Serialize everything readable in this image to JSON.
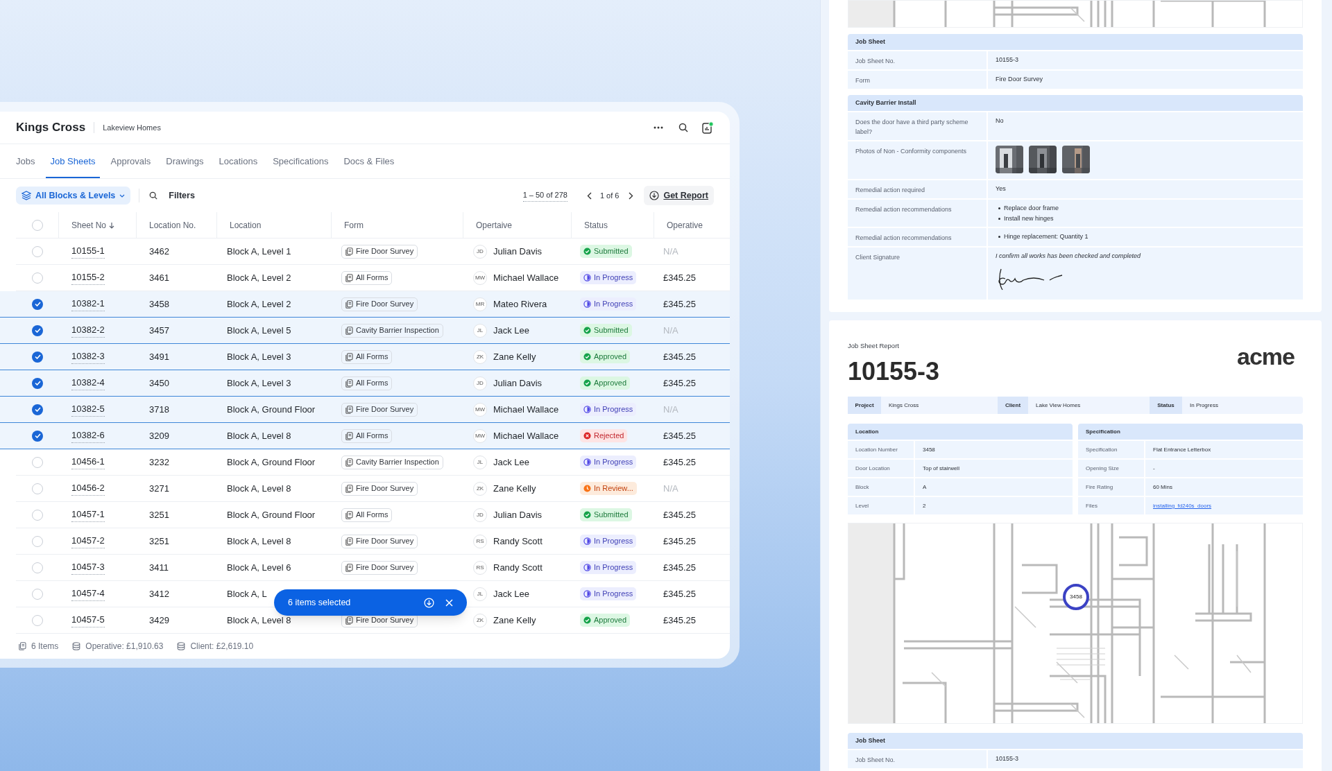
{
  "project": {
    "title": "Kings Cross",
    "client": "Lakeview Homes"
  },
  "tabs": [
    {
      "label": "Jobs",
      "selected": false
    },
    {
      "label": "Job Sheets",
      "selected": true
    },
    {
      "label": "Approvals",
      "selected": false
    },
    {
      "label": "Drawings",
      "selected": false
    },
    {
      "label": "Locations",
      "selected": false
    },
    {
      "label": "Specifications",
      "selected": false
    },
    {
      "label": "Docs & Files",
      "selected": false
    }
  ],
  "toolbar": {
    "filter": "All Blocks & Levels",
    "filters_label": "Filters",
    "range": "1 – 50 of 278",
    "page": "1 of 6",
    "report_button": "Get Report"
  },
  "table": {
    "select_all": false,
    "columns": [
      "Sheet No",
      "Location No.",
      "Location",
      "Form",
      "Opertaive",
      "Status",
      "Operative"
    ],
    "rows": [
      {
        "selected": false,
        "sheet": "10155-1",
        "location_no": "3462",
        "location": "Block A, Level 1",
        "form": "Fire Door Survey",
        "initials": "JD",
        "person": "Julian Davis",
        "status": {
          "label": "Submitted",
          "kind": "submitted"
        },
        "operative": "N/A",
        "operative_muted": true
      },
      {
        "selected": false,
        "sheet": "10155-2",
        "location_no": "3461",
        "location": "Block A, Level 2",
        "form": "All Forms",
        "initials": "MW",
        "person": "Michael Wallace",
        "status": {
          "label": "In Progress",
          "kind": "in_progress"
        },
        "operative": "£345.25",
        "operative_muted": false
      },
      {
        "selected": true,
        "sheet": "10382-1",
        "location_no": "3458",
        "location": "Block A, Level 2",
        "form": "Fire Door Survey",
        "initials": "MR",
        "person": "Mateo Rivera",
        "status": {
          "label": "In Progress",
          "kind": "in_progress"
        },
        "operative": "£345.25",
        "operative_muted": false
      },
      {
        "selected": true,
        "sheet": "10382-2",
        "location_no": "3457",
        "location": "Block A, Level 5",
        "form": "Cavity Barrier Inspection",
        "initials": "JL",
        "person": "Jack Lee",
        "status": {
          "label": "Submitted",
          "kind": "submitted"
        },
        "operative": "N/A",
        "operative_muted": true
      },
      {
        "selected": true,
        "sheet": "10382-3",
        "location_no": "3491",
        "location": "Block A, Level 3",
        "form": "All Forms",
        "initials": "ZK",
        "person": "Zane Kelly",
        "status": {
          "label": "Approved",
          "kind": "approved"
        },
        "operative": "£345.25",
        "operative_muted": false
      },
      {
        "selected": true,
        "sheet": "10382-4",
        "location_no": "3450",
        "location": "Block A, Level 3",
        "form": "All Forms",
        "initials": "JD",
        "person": "Julian Davis",
        "status": {
          "label": "Approved",
          "kind": "approved"
        },
        "operative": "£345.25",
        "operative_muted": false
      },
      {
        "selected": true,
        "sheet": "10382-5",
        "location_no": "3718",
        "location": "Block A, Ground Floor",
        "form": "Fire Door Survey",
        "initials": "MW",
        "person": "Michael Wallace",
        "status": {
          "label": "In Progress",
          "kind": "in_progress"
        },
        "operative": "N/A",
        "operative_muted": true
      },
      {
        "selected": true,
        "sheet": "10382-6",
        "location_no": "3209",
        "location": "Block A, Level 8",
        "form": "All Forms",
        "initials": "MW",
        "person": "Michael Wallace",
        "status": {
          "label": "Rejected",
          "kind": "rejected"
        },
        "operative": "£345.25",
        "operative_muted": false
      },
      {
        "selected": false,
        "sheet": "10456-1",
        "location_no": "3232",
        "location": "Block A, Ground Floor",
        "form": "Cavity Barrier Inspection",
        "initials": "JL",
        "person": "Jack Lee",
        "status": {
          "label": "In Progress",
          "kind": "in_progress"
        },
        "operative": "£345.25",
        "operative_muted": false
      },
      {
        "selected": false,
        "sheet": "10456-2",
        "location_no": "3271",
        "location": "Block A, Level 8",
        "form": "Fire Door Survey",
        "initials": "ZK",
        "person": "Zane Kelly",
        "status": {
          "label": "In Review...",
          "kind": "in_review"
        },
        "operative": "N/A",
        "operative_muted": true
      },
      {
        "selected": false,
        "sheet": "10457-1",
        "location_no": "3251",
        "location": "Block A, Ground Floor",
        "form": "All Forms",
        "initials": "JD",
        "person": "Julian Davis",
        "status": {
          "label": "Submitted",
          "kind": "submitted"
        },
        "operative": "£345.25",
        "operative_muted": false
      },
      {
        "selected": false,
        "sheet": "10457-2",
        "location_no": "3251",
        "location": "Block A, Level 8",
        "form": "Fire Door Survey",
        "initials": "RS",
        "person": "Randy Scott",
        "status": {
          "label": "In Progress",
          "kind": "in_progress"
        },
        "operative": "£345.25",
        "operative_muted": false
      },
      {
        "selected": false,
        "sheet": "10457-3",
        "location_no": "3411",
        "location": "Block A, Level 6",
        "form": "Fire Door Survey",
        "initials": "RS",
        "person": "Randy Scott",
        "status": {
          "label": "In Progress",
          "kind": "in_progress"
        },
        "operative": "£345.25",
        "operative_muted": false
      },
      {
        "selected": false,
        "sheet": "10457-4",
        "location_no": "3412",
        "location": "Block A, L",
        "initials": "JL",
        "person": "Jack Lee",
        "status": {
          "label": "In Progress",
          "kind": "in_progress"
        },
        "operative": "£345.25",
        "operative_muted": false
      },
      {
        "selected": false,
        "sheet": "10457-5",
        "location_no": "3429",
        "location": "Block A, Level 8",
        "form": "Fire Door Survey",
        "initials": "ZK",
        "person": "Zane Kelly",
        "status": {
          "label": "Approved",
          "kind": "approved"
        },
        "operative": "£345.25",
        "operative_muted": false
      }
    ]
  },
  "selection_toast": {
    "label": "6 items selected"
  },
  "footer": {
    "items": "6 Items",
    "operative": "Operative: £1,910.63",
    "client": "Client: £2,619.10"
  },
  "report_top": {
    "sections": [
      {
        "title": "Job Sheet",
        "rows": [
          {
            "kind": "text",
            "label": "Job Sheet No.",
            "value": "10155-3"
          },
          {
            "kind": "text",
            "label": "Form",
            "value": "Fire Door Survey"
          }
        ]
      },
      {
        "title": "Cavity Barrier Install",
        "rows": [
          {
            "kind": "text",
            "label": "Does the door have a third party scheme label?",
            "value": "No"
          },
          {
            "kind": "photos",
            "label": "Photos of Non - Conformity components"
          },
          {
            "kind": "text",
            "label": "Remedial action required",
            "value": "Yes"
          },
          {
            "kind": "list",
            "label": "Remedial action recommendations",
            "items": [
              "Replace door frame",
              "Install new hinges"
            ]
          },
          {
            "kind": "list",
            "label": "Remedial action recommendations",
            "items": [
              "Hinge replacement: Quantity 1"
            ]
          },
          {
            "kind": "signature",
            "label": "Client Signature",
            "value": "I confirm all works has been checked and completed"
          }
        ]
      }
    ]
  },
  "report": {
    "heading": "Job Sheet Report",
    "number": "10155-3",
    "logo": "acme",
    "summary": [
      {
        "label": "Project",
        "value": "Kings Cross"
      },
      {
        "label": "Client",
        "value": "Lake View Homes"
      },
      {
        "label": "Status",
        "value": "In Progress"
      }
    ],
    "tables": [
      {
        "title": "Location",
        "rows": [
          {
            "kind": "text",
            "label": "Location Number",
            "value": "3458"
          },
          {
            "kind": "text",
            "label": "Door Location",
            "value": "Top of stairwell"
          },
          {
            "kind": "text",
            "label": "Block",
            "value": "A"
          },
          {
            "kind": "text",
            "label": "Level",
            "value": "2"
          }
        ]
      },
      {
        "title": "Specification",
        "rows": [
          {
            "kind": "text",
            "label": "Specification",
            "value": "Flat Entrance Letterbox"
          },
          {
            "kind": "text",
            "label": "Opening Size",
            "value": "-"
          },
          {
            "kind": "text",
            "label": "Fire Rating",
            "value": "60 Mins"
          },
          {
            "kind": "link",
            "label": "Files",
            "value": "installing_fd240s_doors"
          }
        ]
      }
    ],
    "pin": "3458",
    "sections": [
      {
        "title": "Job Sheet",
        "rows": [
          {
            "kind": "text",
            "label": "Job Sheet No.",
            "value": "10155-3"
          }
        ]
      }
    ]
  }
}
